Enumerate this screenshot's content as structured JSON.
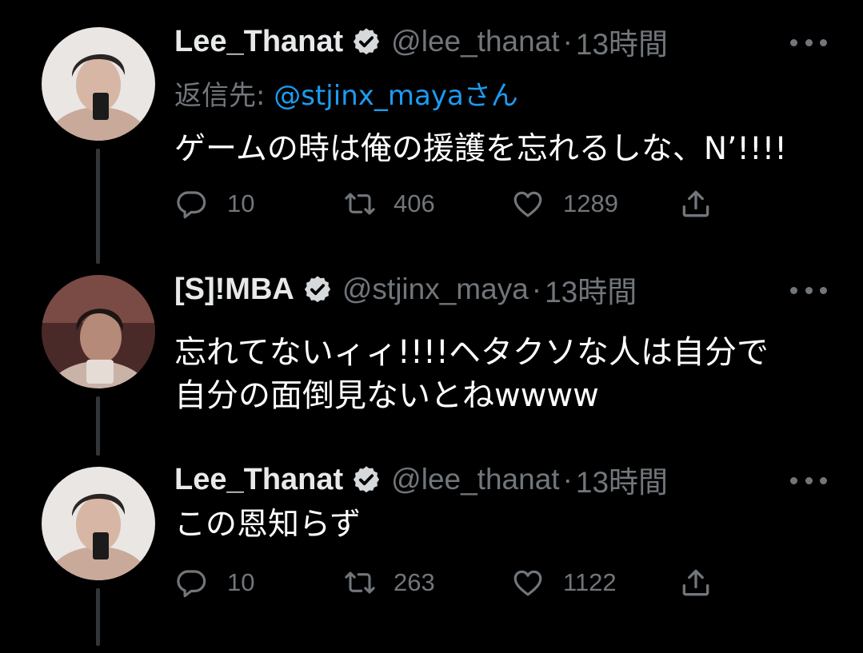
{
  "tweets": [
    {
      "display_name": "Lee_Thanat",
      "handle": "@lee_thanat",
      "separator": "·",
      "time": "13時間",
      "reply_to_prefix": "返信先: ",
      "reply_to_mention": "@stjinx_mayaさん",
      "text_lines": [
        "ゲームの時は俺の援護を忘れるしな、N’!!!!"
      ],
      "replies": "10",
      "retweets": "406",
      "likes": "1289"
    },
    {
      "display_name": "[S]!MBA",
      "handle": "@stjinx_maya",
      "separator": "·",
      "time": "13時間",
      "text_lines": [
        "忘れてないィィ!!!!ヘタクソな人は自分で",
        "自分の面倒見ないとねwwww"
      ]
    },
    {
      "display_name": "Lee_Thanat",
      "handle": "@lee_thanat",
      "separator": "·",
      "time": "13時間",
      "text_lines": [
        "この恩知らず"
      ],
      "replies": "10",
      "retweets": "263",
      "likes": "1122"
    }
  ],
  "colors": {
    "background": "#000000",
    "text": "#ffffff",
    "secondary": "#71767b",
    "link": "#1d9bf0",
    "thread_line": "#333639"
  },
  "icons": [
    "verified-badge-icon",
    "more-icon",
    "reply-icon",
    "retweet-icon",
    "like-icon",
    "share-icon"
  ]
}
